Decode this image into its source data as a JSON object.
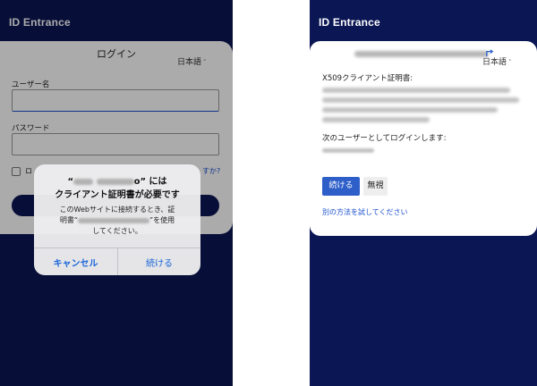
{
  "left_screen": {
    "app_title": "ID Entrance",
    "login_card": {
      "title": "ログイン",
      "language": "日本語",
      "username_label": "ユーザー名",
      "password_label": "パスワード",
      "remember_partial": "ロ",
      "forgot_partial": "すか?"
    },
    "dialog": {
      "title_quote_open": "“",
      "title_quote_close": "” には",
      "title_server_visible": "o",
      "title_line2": "クライアント証明書が必要です",
      "body_line1": "このWebサイトに接続するとき、証",
      "body_line2_prefix": "明書“",
      "body_line2_suffix": "”を使用",
      "body_line3": "してください。",
      "cancel_label": "キャンセル",
      "continue_label": "続ける"
    }
  },
  "right_screen": {
    "app_title": "ID Entrance",
    "language": "日本語",
    "cert_label": "X509クライアント証明書:",
    "next_user_label": "次のユーザーとしてログインします:",
    "continue_label": "続ける",
    "ignore_label": "無視",
    "other_method_link": "別の方法を試してください"
  },
  "icons": {
    "language_chevron": "chevron-down-icon",
    "account_switch": "switch-account-icon"
  },
  "colors": {
    "app_background": "#0b1654",
    "primary_button": "#2e5fc9",
    "ios_link": "#1a66d9",
    "link": "#1b4fcf"
  }
}
